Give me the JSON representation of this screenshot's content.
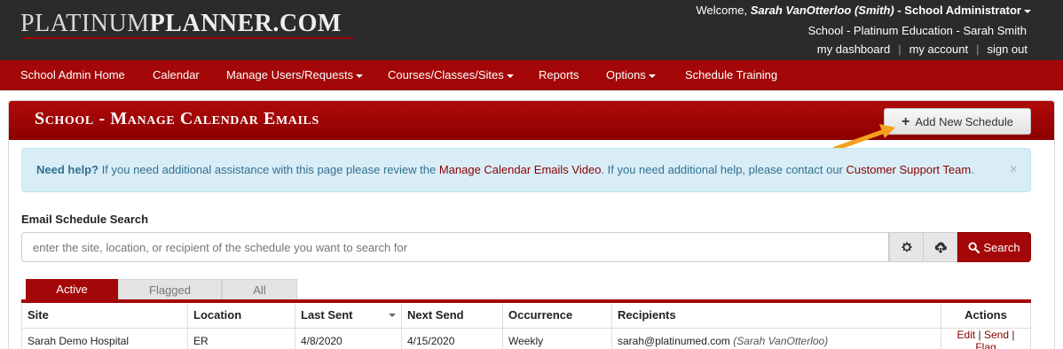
{
  "brand": {
    "logo_part1": "PLATINUM",
    "logo_part2": "PLANNER.COM",
    "accent_color": "#a30707"
  },
  "user": {
    "welcome_prefix": "Welcome,",
    "name": "Sarah VanOtterloo (Smith)",
    "role": "- School Administrator",
    "school_line": "School - Platinum Education - Sarah Smith",
    "links": [
      "my dashboard",
      "my account",
      "sign out"
    ]
  },
  "nav": {
    "items": [
      "School Admin Home",
      "Calendar",
      "Manage Users/Requests",
      "Courses/Classes/Sites",
      "Reports",
      "Options",
      "Schedule Training"
    ]
  },
  "page": {
    "title": "School - Manage Calendar Emails",
    "add_button": "Add New Schedule"
  },
  "help": {
    "lead": "Need help?",
    "text1": " If you need additional assistance with this page please review the ",
    "link1": "Manage Calendar Emails Video",
    "text2": ". If you need additional help, please contact our ",
    "link2": "Customer Support Team",
    "text3": ".",
    "close": "×"
  },
  "search": {
    "label": "Email Schedule Search",
    "placeholder": "enter the site, location, or recipient of the schedule you want to search for",
    "button": "Search"
  },
  "tabs": [
    "Active",
    "Flagged",
    "All"
  ],
  "table": {
    "headers": [
      "Site",
      "Location",
      "Last Sent",
      "Next Send",
      "Occurrence",
      "Recipients",
      "Actions"
    ],
    "rows": [
      {
        "site": "Sarah Demo Hospital",
        "location": "ER",
        "last_sent": "4/8/2020",
        "next_send": "4/15/2020",
        "occurrence": "Weekly",
        "recipient_email": "sarah@platinumed.com",
        "recipient_name": "(Sarah VanOtterloo)",
        "actions": [
          "Edit",
          "Send",
          "Flag"
        ]
      }
    ]
  }
}
